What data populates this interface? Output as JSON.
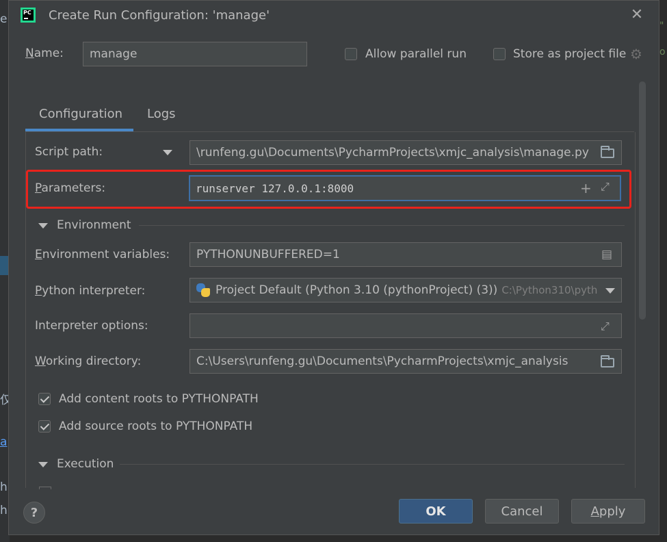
{
  "window": {
    "title": "Create Run Configuration: 'manage'",
    "app_logo_text": "PC"
  },
  "name_row": {
    "label": "Name:",
    "value": "manage",
    "allow_parallel_label": "Allow parallel run",
    "allow_parallel_checked": false,
    "store_project_label": "Store as project file",
    "store_project_checked": false
  },
  "tabs": [
    {
      "label": "Configuration",
      "active": true
    },
    {
      "label": "Logs",
      "active": false
    }
  ],
  "config": {
    "script_path_label": "Script path:",
    "script_path_value": "\\runfeng.gu\\Documents\\PycharmProjects\\xmjc_analysis\\manage.py",
    "parameters_label": "Parameters:",
    "parameters_value": "runserver 127.0.0.1:8000",
    "environment_section": "Environment",
    "env_vars_label": "Environment variables:",
    "env_vars_value": "PYTHONUNBUFFERED=1",
    "interpreter_label": "Python interpreter:",
    "interpreter_value": "Project Default (Python 3.10 (pythonProject) (3))",
    "interpreter_path": "C:\\Python310\\pyth",
    "interp_options_label": "Interpreter options:",
    "interp_options_value": "",
    "working_dir_label": "Working directory:",
    "working_dir_value": "C:\\Users\\runfeng.gu\\Documents\\PycharmProjects\\xmjc_analysis",
    "content_roots_label": "Add content roots to PYTHONPATH",
    "content_roots_checked": true,
    "source_roots_label": "Add source roots to PYTHONPATH",
    "source_roots_checked": true,
    "execution_section": "Execution"
  },
  "buttons": {
    "help": "?",
    "ok": "OK",
    "cancel": "Cancel",
    "apply": "Apply"
  },
  "background": {
    "left_fragments": [
      "er",
      "仅",
      "a",
      "h",
      "h"
    ],
    "right_fragments": [
      "\"",
      "o"
    ]
  },
  "colors": {
    "dialog_bg": "#3c3f41",
    "accent": "#4a88c7",
    "highlight": "#e8231c",
    "ok_button": "#365880"
  }
}
